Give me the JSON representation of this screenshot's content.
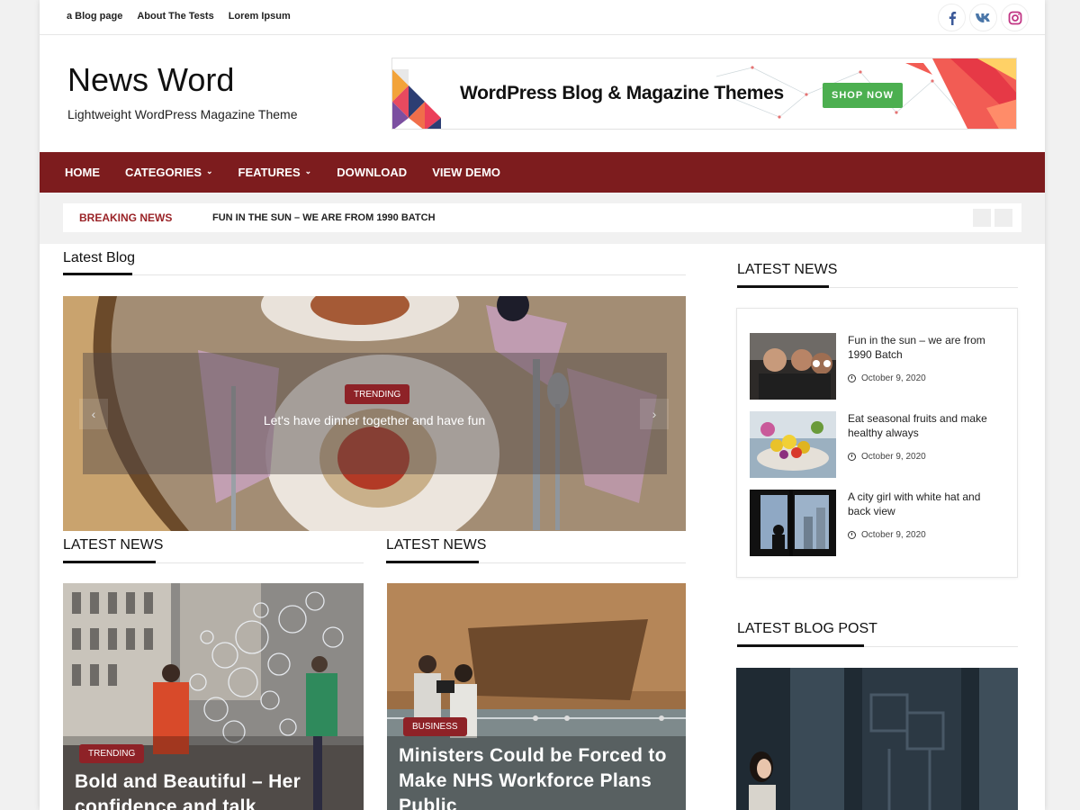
{
  "topbar": {
    "links": [
      "a Blog page",
      "About The Tests",
      "Lorem Ipsum"
    ],
    "social": [
      "facebook-icon",
      "vk-icon",
      "instagram-icon"
    ]
  },
  "header": {
    "site_title": "News Word",
    "tagline": "Lightweight WordPress Magazine Theme",
    "banner_text": "WordPress Blog & Magazine Themes",
    "banner_button": "SHOP NOW"
  },
  "nav": {
    "items": [
      {
        "label": "HOME",
        "dropdown": false
      },
      {
        "label": "CATEGORIES",
        "dropdown": true
      },
      {
        "label": "FEATURES",
        "dropdown": true
      },
      {
        "label": "DOWNLOAD",
        "dropdown": false
      },
      {
        "label": "VIEW DEMO",
        "dropdown": false
      }
    ]
  },
  "breaking": {
    "label": "BREAKING NEWS",
    "text": "FUN IN THE SUN – WE ARE FROM 1990 BATCH"
  },
  "main": {
    "latest_blog_heading": "Latest Blog",
    "slider": {
      "badge": "TRENDING",
      "title": "Let's have dinner together and have fun"
    },
    "left_heading": "LATEST NEWS",
    "right_heading": "LATEST NEWS",
    "card_left": {
      "badge": "TRENDING",
      "title": "Bold and Beautiful – Her confidence and talk"
    },
    "card_right": {
      "badge": "BUSINESS",
      "title": "Ministers Could be Forced to Make NHS Workforce Plans Public"
    }
  },
  "sidebar": {
    "latest_news_heading": "LATEST NEWS",
    "items": [
      {
        "title": "Fun in the sun – we are from 1990 Batch",
        "date": "October 9, 2020"
      },
      {
        "title": "Eat seasonal fruits and make healthy always",
        "date": "October 9, 2020"
      },
      {
        "title": "A city girl with white hat and back view",
        "date": "October 9, 2020"
      }
    ],
    "blog_post_heading": "LATEST BLOG POST"
  },
  "colors": {
    "nav_bg": "#7d1c1e",
    "badge": "#8e2227",
    "breaking_label": "#9a2327",
    "shop_button": "#4caf50"
  }
}
